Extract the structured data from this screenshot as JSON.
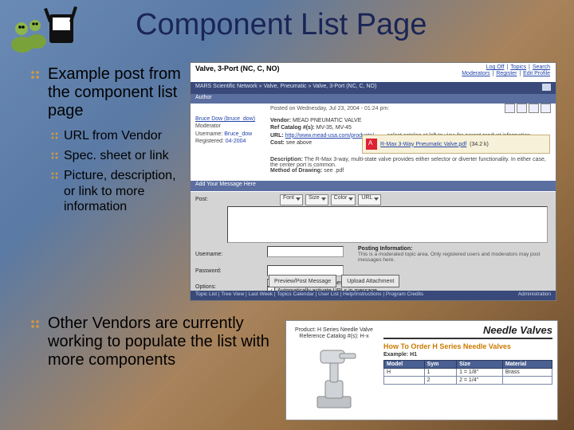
{
  "title": "Component List Page",
  "bullets": {
    "b1": "Example post from the component list page",
    "subs": [
      "URL from Vendor",
      "Spec. sheet or link",
      "Picture, description, or link to more information"
    ],
    "b2": "Other Vendors are currently working to populate the list with more components"
  },
  "forum": {
    "thread_title": "Valve, 3-Port (NC, C, NO)",
    "top_links": [
      "Log Off",
      "Topics",
      "Search",
      "Moderators",
      "Register",
      "Edit Profile"
    ],
    "breadcrumb": "MARS Scientific Network » Valve, Pneumatic » Valve, 3-Port (NC, C, NO)",
    "author_header": "Author",
    "post_date": "Posted on Wednesday, Jul 23, 2004 - 01:24 pm:",
    "side": {
      "name_link": "Bruce Dow (bruce_dow)",
      "role": "Moderator",
      "uname_lbl": "Username:",
      "uname": "Bruce_dow",
      "reg_lbl": "Registered:",
      "reg": "04-2004"
    },
    "body": {
      "l1_lbl": "Vendor:",
      "l1": "MEAD PNEUMATIC VALVE",
      "l2_lbl": "Ref Catalog #(s):",
      "l2": "MV-35, MV-45",
      "l3_lbl": "URL:",
      "l3": "http://www.mead-usa.com/products/...",
      "l3_tail": "— select catalog at left to view for parent product information",
      "l4_lbl": "Cost:",
      "l4": "see above",
      "desc_lbl": "Description:",
      "desc": "The R-Max 3-way, multi-state valve provides either selector or diverter functionality. In either case, the center port is common.",
      "draw_lbl": "Method of Drawing:",
      "draw": "see .pdf"
    },
    "attach": {
      "name": "R-Max 3-Way Pneumatic Valve.pdf",
      "meta": "(34.2 k)"
    },
    "reply_header": "Add Your Message Here",
    "form": {
      "post_lbl": "Post:",
      "dd": [
        "Font",
        "Size",
        "Color",
        "URL"
      ],
      "user_lbl": "Username:",
      "pass_lbl": "Password:",
      "opt_lbl": "Options:",
      "posting_hdr": "Posting Information:",
      "posting_note": "This is a moderated topic area. Only registered users and moderators may post messages here.",
      "cb1": "Enable HTML code in message",
      "cb2": "Automatically activate URLs in message",
      "btn1": "Preview/Post Message",
      "btn2": "Upload Attachment"
    },
    "footer_left": "Topic List | Tree View | Last Week | Topics Calendar | User List | Help/Instructions | Program Credits",
    "footer_right": "Administration"
  },
  "catalog": {
    "prod1": "Product: H Series Needle Valve",
    "prod2": "Reference Catalog #(s): H-x",
    "header": "Needle Valves",
    "subhead": "How To Order H Series Needle Valves",
    "example": "Example: H1",
    "th": [
      "Model",
      "Sym",
      "Size",
      "Material"
    ],
    "rows": [
      [
        "H",
        "1",
        "1 = 1/8\"",
        "Brass"
      ],
      [
        "",
        "2",
        "2 = 1/4\"",
        ""
      ]
    ]
  }
}
